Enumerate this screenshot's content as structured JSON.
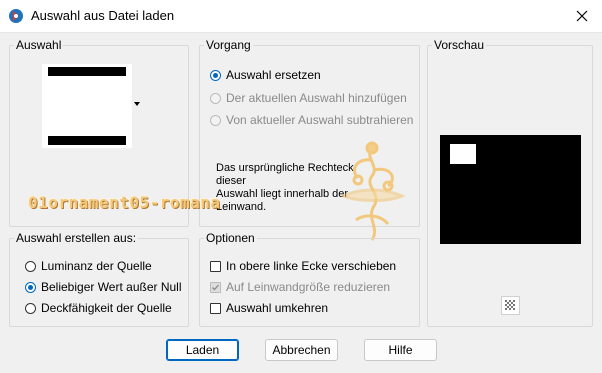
{
  "window": {
    "title": "Auswahl aus Datei laden"
  },
  "groups": {
    "auswahl": {
      "label": "Auswahl"
    },
    "vorgang": {
      "label": "Vorgang",
      "options": [
        {
          "label": "Auswahl ersetzen",
          "selected": true,
          "enabled": true
        },
        {
          "label": "Der aktuellen Auswahl hinzufügen",
          "selected": false,
          "enabled": false
        },
        {
          "label": "Von aktueller Auswahl subtrahieren",
          "selected": false,
          "enabled": false
        }
      ],
      "info_line1": "Das ursprüngliche Rechteck dieser",
      "info_line2": "Auswahl liegt innerhalb der",
      "info_line3": "Leinwand."
    },
    "vorschau": {
      "label": "Vorschau"
    },
    "erstellen": {
      "label": "Auswahl erstellen aus:",
      "options": [
        {
          "label": "Luminanz der Quelle",
          "selected": false
        },
        {
          "label": "Beliebiger Wert außer Null",
          "selected": true
        },
        {
          "label": "Deckfähigkeit der Quelle",
          "selected": false
        }
      ]
    },
    "optionen": {
      "label": "Optionen",
      "checks": [
        {
          "label": "In obere linke Ecke verschieben",
          "checked": false,
          "enabled": true
        },
        {
          "label": "Auf Leinwandgröße reduzieren",
          "checked": true,
          "enabled": false
        },
        {
          "label": "Auswahl umkehren",
          "checked": false,
          "enabled": true
        }
      ]
    }
  },
  "buttons": {
    "load": "Laden",
    "cancel": "Abbrechen",
    "help": "Hilfe"
  },
  "watermark": "01ornament05-romana",
  "icons": {
    "app": "paintshop-icon",
    "close": "close-icon",
    "checker": "checkerboard-icon",
    "dropdown": "dropdown-arrow-icon"
  },
  "colors": {
    "accent": "#0067c0",
    "watermark": "#f4c87a"
  }
}
